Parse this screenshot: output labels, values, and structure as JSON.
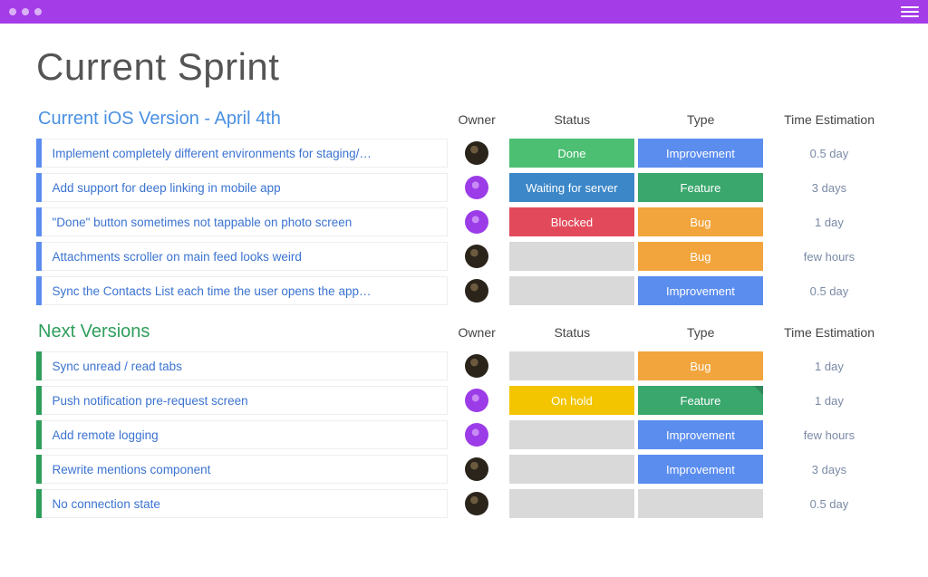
{
  "colors": {
    "titlebar": "#a43ce8",
    "stripe_current": "#5b8def",
    "stripe_next": "#2e9e5b",
    "group_title_current": "#4a90e2",
    "group_title_next": "#2e9e5b",
    "status": {
      "Done": "#4cbf73",
      "Waiting for server": "#3b87c8",
      "Blocked": "#e24a5b",
      "On hold": "#f2c500",
      "empty": "#d9d9d9"
    },
    "type": {
      "Improvement": "#5b8def",
      "Feature": "#3aa76d",
      "Bug": "#f2a53c"
    }
  },
  "page": {
    "title": "Current Sprint"
  },
  "columns": {
    "owner": "Owner",
    "status": "Status",
    "type": "Type",
    "time": "Time Estimation"
  },
  "groups": [
    {
      "id": "current",
      "title": "Current iOS Version - April 4th",
      "title_color": "group_title_current",
      "stripe_color": "stripe_current",
      "rows": [
        {
          "name": "Implement completely different environments for staging/…",
          "owner": "dark",
          "status": "Done",
          "type": "Improvement",
          "time": "0.5 day"
        },
        {
          "name": "Add support for deep linking in mobile app",
          "owner": "purple",
          "status": "Waiting for server",
          "type": "Feature",
          "time": "3 days"
        },
        {
          "name": "\"Done\" button sometimes not tappable on photo screen",
          "owner": "purple",
          "status": "Blocked",
          "type": "Bug",
          "time": "1 day"
        },
        {
          "name": "Attachments scroller on main feed looks weird",
          "owner": "dark",
          "status": "",
          "type": "Bug",
          "time": "few hours"
        },
        {
          "name": "Sync the Contacts List each time the user opens the app…",
          "owner": "dark",
          "status": "",
          "type": "Improvement",
          "time": "0.5 day"
        }
      ]
    },
    {
      "id": "next",
      "title": "Next Versions",
      "title_color": "group_title_next",
      "stripe_color": "stripe_next",
      "rows": [
        {
          "name": "Sync unread / read tabs",
          "owner": "dark",
          "status": "",
          "type": "Bug",
          "time": "1 day"
        },
        {
          "name": "Push notification pre-request screen",
          "owner": "purple",
          "status": "On hold",
          "type": "Feature",
          "time": "1 day",
          "type_dogear": true
        },
        {
          "name": "Add remote logging",
          "owner": "purple",
          "status": "",
          "type": "Improvement",
          "time": "few hours"
        },
        {
          "name": "Rewrite mentions component",
          "owner": "dark",
          "status": "",
          "type": "Improvement",
          "time": "3 days"
        },
        {
          "name": "No connection state",
          "owner": "dark",
          "status": "",
          "type": "",
          "time": "0.5 day"
        }
      ]
    }
  ]
}
